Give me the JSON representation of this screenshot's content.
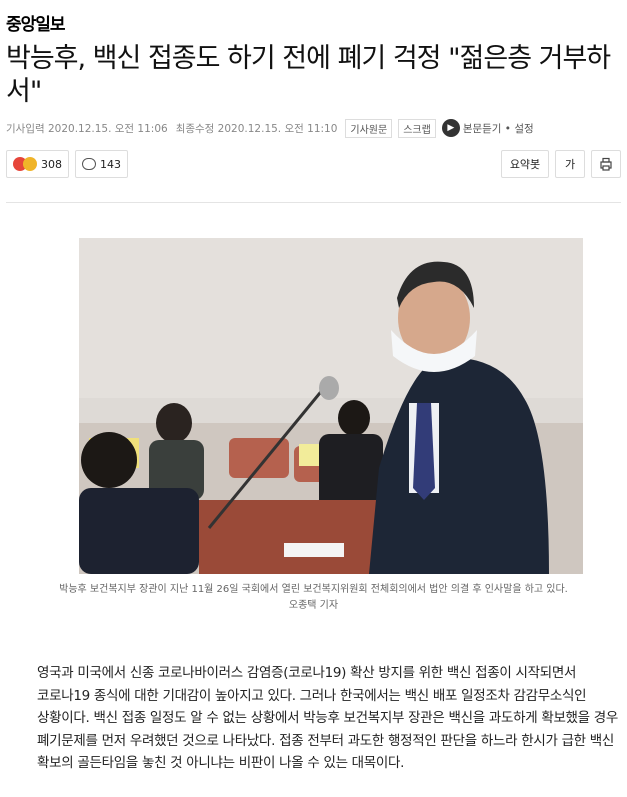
{
  "press_name": "중앙일보",
  "headline": "박능후, 백신 접종도 하기 전에 폐기 걱정 \"젊은층 거부하서\"",
  "meta": {
    "published": "기사입력 2020.12.15. 오전 11:06",
    "modified": "최종수정 2020.12.15. 오전 11:10",
    "original_label": "기사원문",
    "scrap_label": "스크랩",
    "listen_label": "본문듣기 • 설정"
  },
  "reactions": {
    "emotion_count": "308",
    "comment_count": "143"
  },
  "tools": {
    "summary_label": "요약봇",
    "font_label": "가"
  },
  "photo": {
    "caption": "박능후 보건복지부 장관이 지난 11월 26일 국회에서 열린 보건복지위원회 전체회의에서 법안 의결 후 인사말을 하고 있다.",
    "credit": "오종택 기자",
    "colors": {
      "wall": "#dcd8d4",
      "suit": "#1d2636",
      "chair": "#b5614e"
    }
  },
  "body": "영국과 미국에서 신종 코로나바이러스 감염증(코로나19) 확산 방지를 위한 백신 접종이 시작되면서 코로나19 종식에 대한 기대감이 높아지고 있다. 그러나 한국에서는 백신 배포 일정조차 감감무소식인 상황이다. 백신 접종 일정도 알 수 없는 상황에서 박능후 보건복지부 장관은 백신을 과도하게 확보했을 경우 폐기문제를 먼저 우려했던 것으로 나타났다. 접종 전부터 과도한 행정적인 판단을 하느라 한시가 급한 백신 확보의 골든타임을 놓친 것 아니냐는 비판이 나올 수 있는 대목이다."
}
